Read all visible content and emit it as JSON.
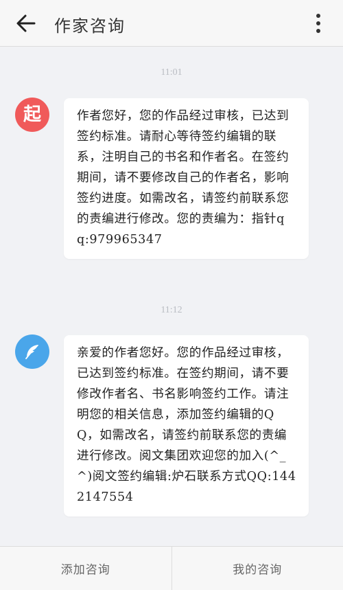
{
  "header": {
    "title": "作家咨询",
    "back_icon": "arrow-left-icon",
    "more_icon": "more-vertical-icon"
  },
  "messages": [
    {
      "time": "11:01",
      "avatar_text": "起",
      "avatar_color": "#f05a5a",
      "text": "作者您好，您的作品经过审核，已达到签约标准。请耐心等待签约编辑的联系，注明自己的书名和作者名。在签约期间，请不要修改自己的作者名，影响签约进度。如需改名，请签约前联系您的责编进行修改。您的责编为：指针qq:979965347"
    },
    {
      "time": "11:12",
      "avatar_icon": "feather-icon",
      "avatar_color": "#4aa6ea",
      "text": "亲爱的作者您好。您的作品经过审核，已达到签约标准。在签约期间，请不要修改作者名、书名影响签约工作。请注明您的相关信息，添加签约编辑的QQ，如需改名，请签约前联系您的责编进行修改。阅文集团欢迎您的加入(^_^)阅文签约编辑:炉石联系方式QQ:1442147554"
    }
  ],
  "footer": {
    "add_label": "添加咨询",
    "mine_label": "我的咨询"
  }
}
